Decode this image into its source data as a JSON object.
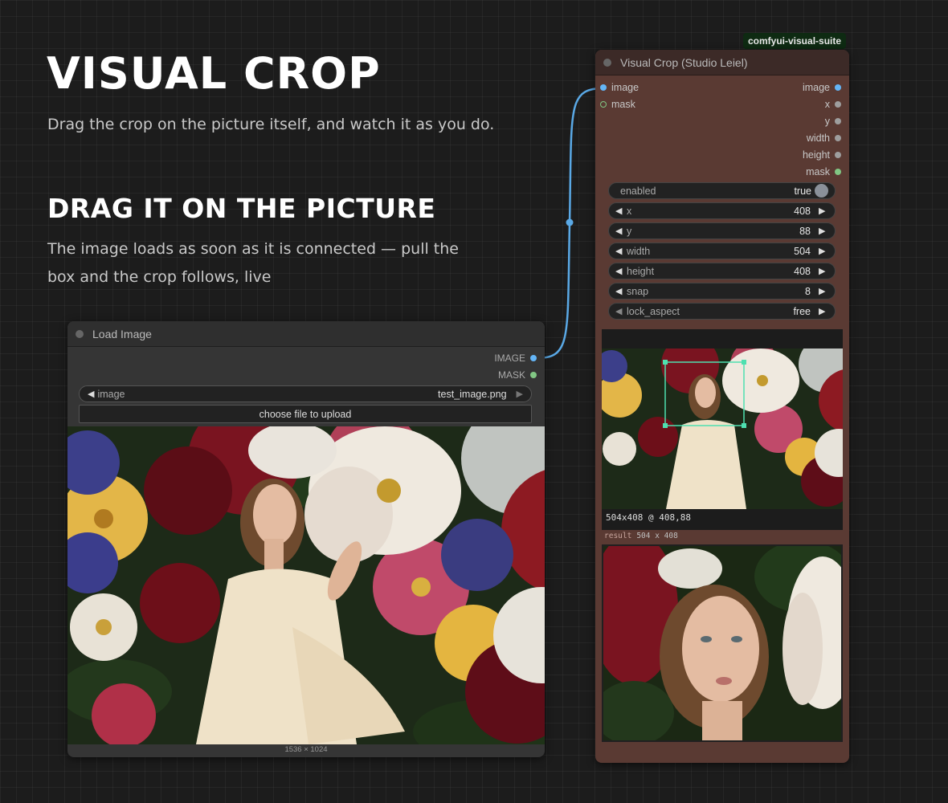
{
  "hero": {
    "title": "VISUAL CROP",
    "subtitle": "Drag the crop on the picture itself, and watch it as you do."
  },
  "section": {
    "title": "DRAG IT ON THE PICTURE",
    "body": "The image loads as soon as it is connected — pull the box and the crop follows, live"
  },
  "load_image_node": {
    "title": "Load Image",
    "outputs": [
      {
        "label": "IMAGE",
        "color": "#64b5f6"
      },
      {
        "label": "MASK",
        "color": "#81c784"
      }
    ],
    "image_widget": {
      "label": "image",
      "value": "test_image.png"
    },
    "upload_button": "choose file to upload",
    "caption": "1536 × 1024"
  },
  "crop_node": {
    "badge": "comfyui-visual-suite",
    "title": "Visual Crop (Studio Leiel)",
    "inputs": [
      {
        "label": "image",
        "color": "#64b5f6"
      },
      {
        "label": "mask",
        "color": "#81c784"
      }
    ],
    "outputs": [
      {
        "label": "image",
        "color": "#64b5f6"
      },
      {
        "label": "x",
        "color": "#9e9e9e"
      },
      {
        "label": "y",
        "color": "#9e9e9e"
      },
      {
        "label": "width",
        "color": "#9e9e9e"
      },
      {
        "label": "height",
        "color": "#9e9e9e"
      },
      {
        "label": "mask",
        "color": "#81c784"
      }
    ],
    "enabled": {
      "label": "enabled",
      "value": "true"
    },
    "widgets": [
      {
        "label": "x",
        "value": "408"
      },
      {
        "label": "y",
        "value": "88"
      },
      {
        "label": "width",
        "value": "504"
      },
      {
        "label": "height",
        "value": "408"
      },
      {
        "label": "snap",
        "value": "8"
      },
      {
        "label": "lock_aspect",
        "value": "free"
      }
    ],
    "crop_readout": "504x408 @ 408,88",
    "result_label": "result",
    "result_size": "504 x 408",
    "crop_box_color": "#4ee0b0"
  },
  "wire_color": "#5aa9e6"
}
